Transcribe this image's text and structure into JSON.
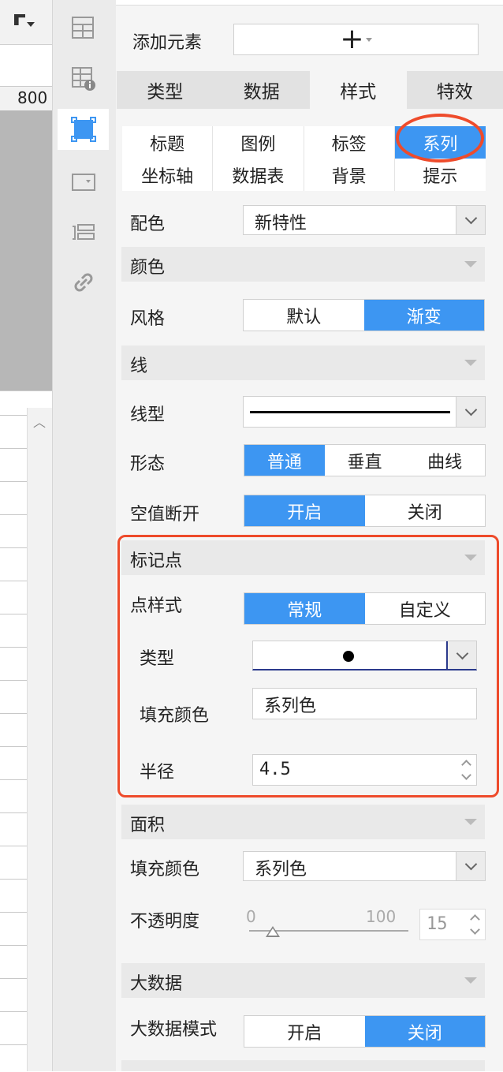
{
  "ruler": {
    "value": "800"
  },
  "add_element": {
    "label": "添加元素"
  },
  "main_tabs": [
    "类型",
    "数据",
    "样式",
    "特效"
  ],
  "sub_tabs": [
    "标题",
    "图例",
    "标签",
    "系列",
    "坐标轴",
    "数据表",
    "背景",
    "提示"
  ],
  "color_scheme": {
    "label": "配色",
    "value": "新特性"
  },
  "section_color": "颜色",
  "style": {
    "label": "风格",
    "options": [
      "默认",
      "渐变"
    ],
    "selected": "渐变"
  },
  "section_line": "线",
  "line_type": {
    "label": "线型"
  },
  "shape": {
    "label": "形态",
    "options": [
      "普通",
      "垂直",
      "曲线"
    ],
    "selected": "普通"
  },
  "null_break": {
    "label": "空值断开",
    "options": [
      "开启",
      "关闭"
    ],
    "selected": "开启"
  },
  "section_marker": "标记点",
  "marker_style": {
    "label": "点样式",
    "options": [
      "常规",
      "自定义"
    ],
    "selected": "常规"
  },
  "marker_type": {
    "label": "类型"
  },
  "marker_fill": {
    "label": "填充颜色",
    "value": "系列色"
  },
  "marker_radius": {
    "label": "半径",
    "value": "4.5"
  },
  "section_area": "面积",
  "area_fill": {
    "label": "填充颜色",
    "value": "系列色"
  },
  "opacity": {
    "label": "不透明度",
    "min": "0",
    "max": "100",
    "value": "15",
    "fraction": 0.15
  },
  "section_bigdata": "大数据",
  "bigdata_mode": {
    "label": "大数据模式",
    "options": [
      "开启",
      "关闭"
    ],
    "selected": "关闭"
  },
  "colors": {
    "accent": "#3d96f2",
    "highlight": "#ee4b2b"
  }
}
